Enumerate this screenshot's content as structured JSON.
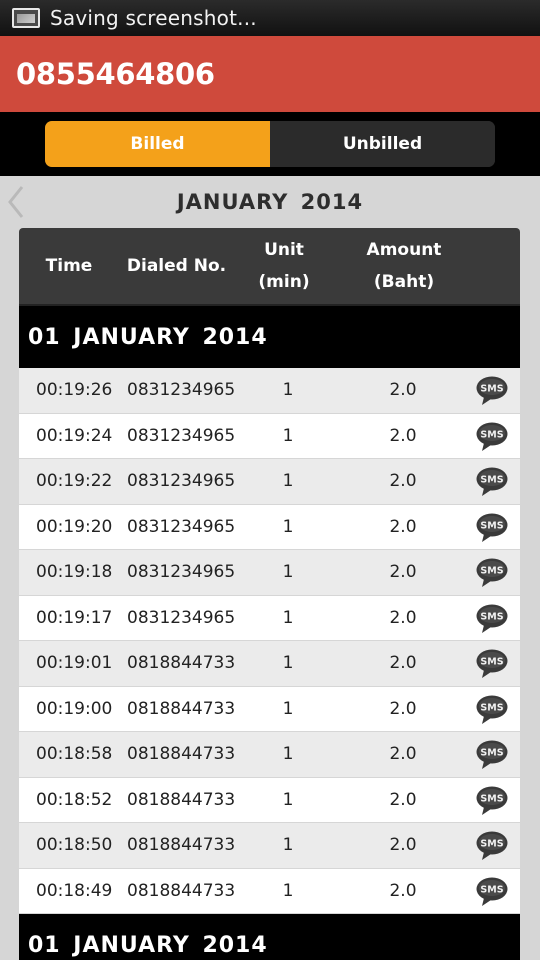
{
  "status_bar": {
    "text": "Saving screenshot...",
    "icon": "screenshot-icon"
  },
  "header": {
    "phone_number": "0855464806"
  },
  "tabs": [
    {
      "label": "Billed",
      "active": true
    },
    {
      "label": "Unbilled",
      "active": false
    }
  ],
  "month": {
    "title": "JANUARY 2014",
    "back_icon": "chevron-left-icon"
  },
  "table": {
    "headers": {
      "time": "Time",
      "dialed": "Dialed No.",
      "unit_line1": "Unit",
      "unit_line2": "(min)",
      "amount_line1": "Amount",
      "amount_line2": "(Baht)"
    },
    "date_groups": [
      {
        "date": "01 JANUARY 2014",
        "rows": [
          {
            "time": "00:19:26",
            "number": "0831234965",
            "unit": "1",
            "amount": "2.0",
            "type": "SMS"
          },
          {
            "time": "00:19:24",
            "number": "0831234965",
            "unit": "1",
            "amount": "2.0",
            "type": "SMS"
          },
          {
            "time": "00:19:22",
            "number": "0831234965",
            "unit": "1",
            "amount": "2.0",
            "type": "SMS"
          },
          {
            "time": "00:19:20",
            "number": "0831234965",
            "unit": "1",
            "amount": "2.0",
            "type": "SMS"
          },
          {
            "time": "00:19:18",
            "number": "0831234965",
            "unit": "1",
            "amount": "2.0",
            "type": "SMS"
          },
          {
            "time": "00:19:17",
            "number": "0831234965",
            "unit": "1",
            "amount": "2.0",
            "type": "SMS"
          },
          {
            "time": "00:19:01",
            "number": "0818844733",
            "unit": "1",
            "amount": "2.0",
            "type": "SMS"
          },
          {
            "time": "00:19:00",
            "number": "0818844733",
            "unit": "1",
            "amount": "2.0",
            "type": "SMS"
          },
          {
            "time": "00:18:58",
            "number": "0818844733",
            "unit": "1",
            "amount": "2.0",
            "type": "SMS"
          },
          {
            "time": "00:18:52",
            "number": "0818844733",
            "unit": "1",
            "amount": "2.0",
            "type": "SMS"
          },
          {
            "time": "00:18:50",
            "number": "0818844733",
            "unit": "1",
            "amount": "2.0",
            "type": "SMS"
          },
          {
            "time": "00:18:49",
            "number": "0818844733",
            "unit": "1",
            "amount": "2.0",
            "type": "SMS"
          }
        ]
      },
      {
        "date": "01 JANUARY 2014",
        "rows": []
      }
    ]
  },
  "colors": {
    "header_red": "#cf4a3c",
    "active_tab_orange": "#f4a11a",
    "table_header_gray": "#3a3a3a"
  }
}
